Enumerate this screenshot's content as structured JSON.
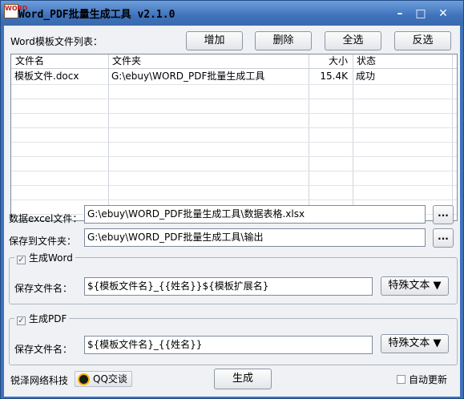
{
  "window": {
    "title": "Word_PDF批量生成工具 v2.1.0",
    "icon_text": "WORD"
  },
  "template_list": {
    "label": "Word模板文件列表：",
    "buttons": {
      "add": "增加",
      "delete": "删除",
      "select_all": "全选",
      "invert": "反选"
    },
    "columns": [
      "文件名",
      "文件夹",
      "大小",
      "状态"
    ],
    "rows": [
      [
        "模板文件.docx",
        "G:\\ebuy\\WORD_PDF批量生成工具",
        "15.4K",
        "成功"
      ]
    ]
  },
  "excel": {
    "label": "数据excel文件：",
    "value": "G:\\ebuy\\WORD_PDF批量生成工具\\数据表格.xlsx",
    "browse": "..."
  },
  "output": {
    "label": "保存到文件夹：",
    "value": "G:\\ebuy\\WORD_PDF批量生成工具\\输出",
    "browse": "..."
  },
  "word_group": {
    "legend": "生成Word",
    "checked": true,
    "filename_label": "保存文件名：",
    "filename_value": "${模板文件名}_{{姓名}}${模板扩展名}",
    "special_button": "特殊文本 ▼"
  },
  "pdf_group": {
    "legend": "生成PDF",
    "checked": true,
    "filename_label": "保存文件名：",
    "filename_value": "${模板文件名}_{{姓名}}",
    "special_button": "特殊文本 ▼"
  },
  "footer": {
    "company": "锐泽网络科技",
    "qq_label": "QQ交谈",
    "generate": "生成",
    "auto_update": "自动更新",
    "auto_update_checked": false
  },
  "icons": {
    "minimize": "minimize-icon",
    "maximize": "maximize-icon",
    "close": "close-icon",
    "check": "check-icon",
    "qq": "qq-penguin-icon"
  }
}
